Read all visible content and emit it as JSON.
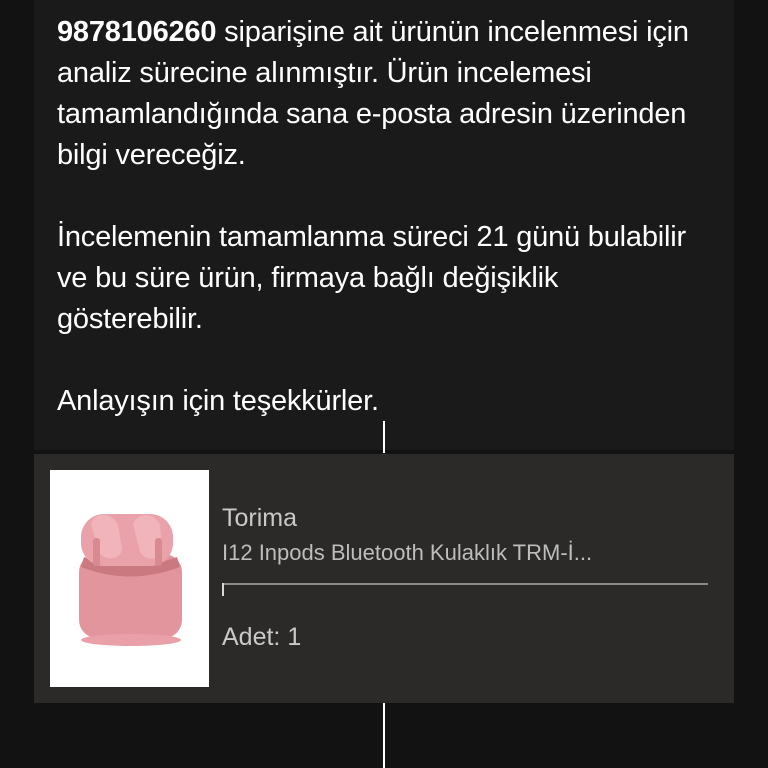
{
  "message": {
    "order_number": "9878106260",
    "paragraph1_rest": " siparişine ait ürünün incelenmesi için analiz sürecine alınmıştır. Ürün incelemesi tamamlandığında sana e-posta adresin üzerinden bilgi vereceğiz.",
    "paragraph2": "İncelemenin tamamlanma süreci 21 günü bulabilir ve bu süre ürün, firmaya bağlı değişiklik gösterebilir.",
    "paragraph3": "Anlayışın için teşekkürler."
  },
  "product": {
    "brand": "Torima",
    "name": "I12 Inpods Bluetooth Kulaklık TRM-İ...",
    "quantity": "Adet: 1",
    "image_icon": "pink-wireless-earbuds-case",
    "colors": {
      "case": "#e3959d",
      "case_shadow": "#c9797f"
    }
  },
  "colors": {
    "background": "#121212",
    "panel": "#1a1a1b",
    "card": "#2b2a28",
    "text": "#ffffff",
    "muted_text": "#c9c9c9"
  }
}
